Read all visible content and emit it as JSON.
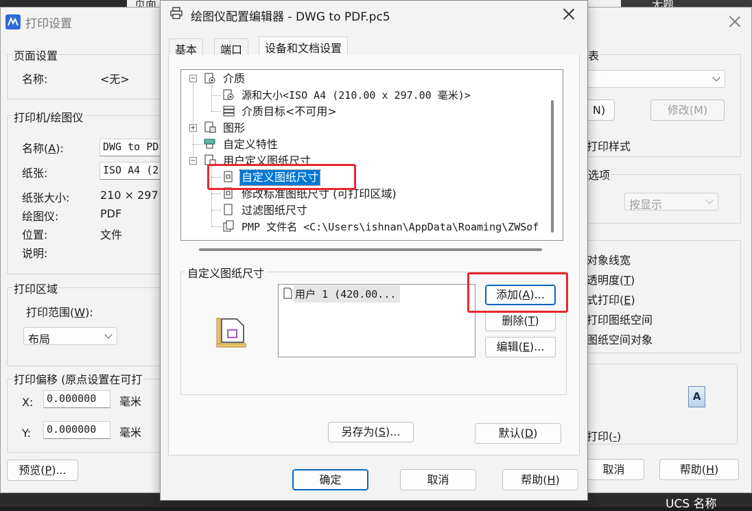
{
  "background": {
    "partial_text_top": "页面",
    "partial_text_right": "无题",
    "ucs_label": "UCS 名称"
  },
  "print_dialog": {
    "title": "打印设置",
    "page_setup": {
      "label": "页面设置",
      "name_label": "名称:",
      "name_value": "<无>"
    },
    "printer": {
      "label": "打印机/绘图仪",
      "name_label": "名称(A):",
      "name_value": "DWG to PDF",
      "paper_label": "纸张:",
      "paper_value": "ISO A4 (2",
      "paper_size_label": "纸张大小:",
      "paper_size_value": "210 × 297",
      "plotter_label": "绘图仪:",
      "plotter_value": "PDF",
      "location_label": "位置:",
      "location_value": "文件",
      "desc_label": "说明:"
    },
    "area": {
      "label": "打印区域",
      "range_label": "打印范围(W):",
      "range_value": "布局"
    },
    "offset": {
      "label": "打印偏移 (原点设置在可打",
      "x_label": "X:",
      "x_value": "0.000000",
      "x_unit": "毫米",
      "y_label": "Y:",
      "y_value": "0.000000",
      "y_unit": "毫米"
    },
    "preview_button": "预览(P)...",
    "right": {
      "table_label": "表",
      "new_button": "N)",
      "modify_button": "修改(M)",
      "print_style": "打印样式",
      "options_label": "选项",
      "shade_value": "按显示",
      "opt1": "对象线宽",
      "opt2": "透明度(T)",
      "opt3": "式打印(E)",
      "opt4": "打印图纸空间",
      "opt5": "图纸空间对象",
      "orientation_icon_letter": "A",
      "reverse_print": "打印(-)",
      "cancel_button": "取消",
      "help_button": "帮助(H)"
    }
  },
  "editor": {
    "title": "绘图仪配置编辑器 - DWG to PDF.pc5",
    "tabs": [
      "基本",
      "端口",
      "设备和文档设置"
    ],
    "active_tab": 2,
    "tree": [
      {
        "label": "介质",
        "icon": "media-icon"
      },
      {
        "label": "源和大小<ISO A4 (210.00 x 297.00 毫米)>",
        "icon": "source-size-icon"
      },
      {
        "label": "介质目标<不可用>",
        "icon": "media-destination-icon"
      },
      {
        "label": "图形",
        "icon": "graphics-icon"
      },
      {
        "label": "自定义特性",
        "icon": "custom-properties-icon"
      },
      {
        "label": "用户定义图纸尺寸",
        "icon": "user-paper-icon"
      },
      {
        "label": "自定义图纸尺寸",
        "icon": "custom-paper-size-icon",
        "selected": true
      },
      {
        "label": "修改标准图纸尺寸 (可打印区域)",
        "icon": "modify-paper-icon"
      },
      {
        "label": "过滤图纸尺寸",
        "icon": "filter-paper-icon"
      },
      {
        "label": "PMP 文件名 <C:\\Users\\ishnan\\AppData\\Roaming\\ZWSof",
        "icon": "pmp-file-icon"
      }
    ],
    "custom_group": {
      "label": "自定义图纸尺寸",
      "list_items": [
        "用户 1 (420.00..."
      ],
      "add_button": "添加(A)...",
      "delete_button": "删除(T)",
      "edit_button": "编辑(E)..."
    },
    "save_as_button": "另存为(S)...",
    "default_button": "默认(D)",
    "ok_button": "确定",
    "cancel_button": "取消",
    "help_button": "帮助(H)",
    "highlight_color": "#e8262f",
    "selection_color": "#0078d4"
  }
}
